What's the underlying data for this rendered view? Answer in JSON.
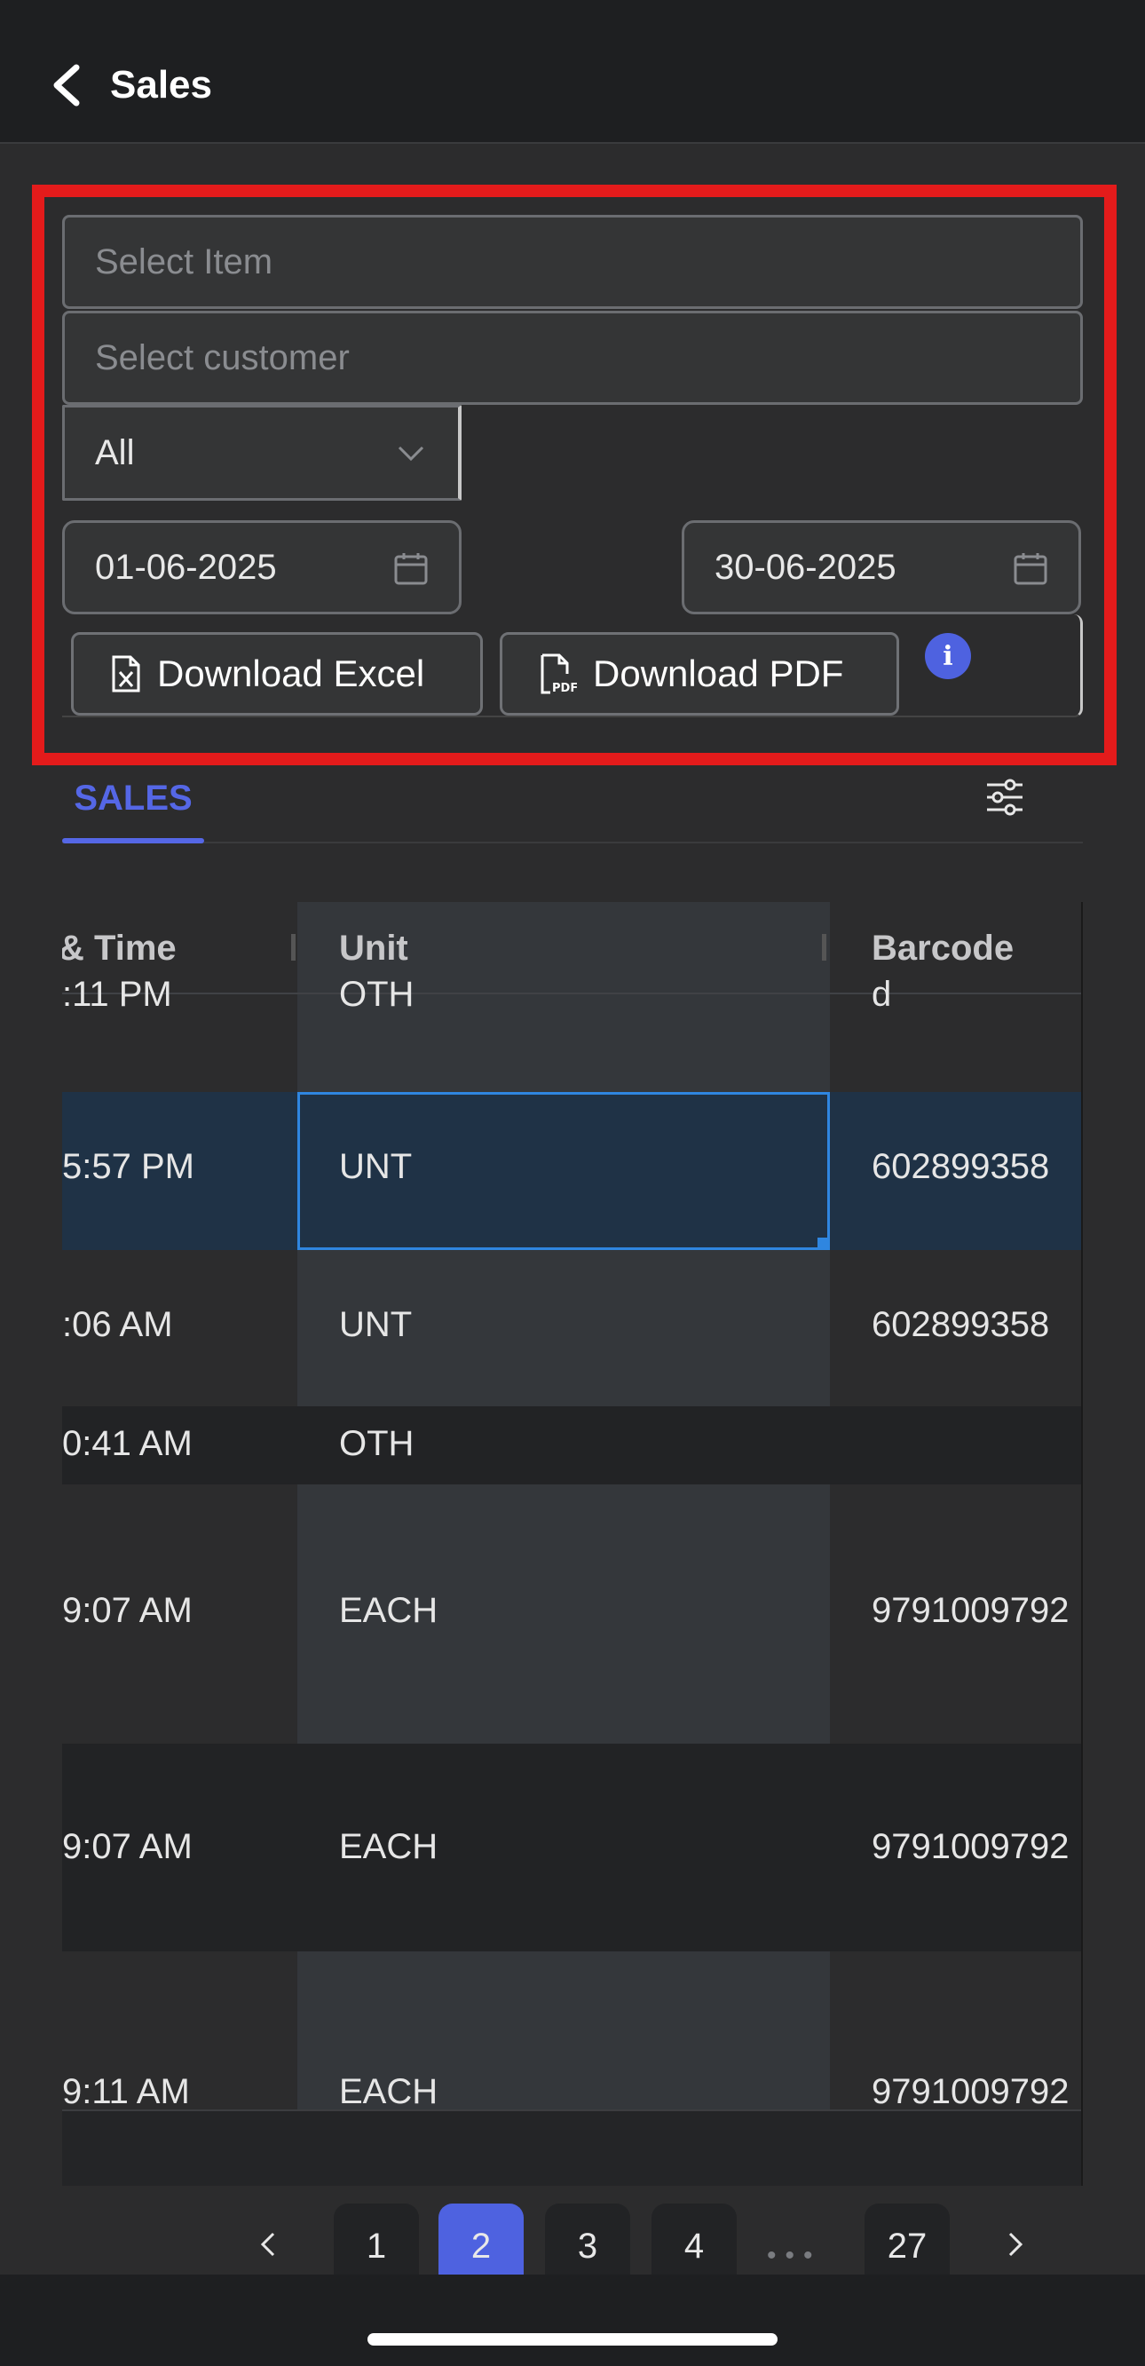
{
  "header": {
    "title": "Sales",
    "back_icon": "chevron-left-icon"
  },
  "filters": {
    "item_placeholder": "Select Item",
    "customer_placeholder": "Select customer",
    "type_select": {
      "value": "All"
    },
    "from_date": "01-06-2025",
    "to_date": "30-06-2025",
    "download_excel_label": "Download Excel",
    "download_pdf_label": "Download PDF",
    "info_icon_glyph": "i"
  },
  "tabs": [
    {
      "label": "SALES",
      "active": true
    }
  ],
  "grid": {
    "columns": [
      "& Time",
      "Unit",
      "Barcode"
    ],
    "rows": [
      {
        "time": ":11 PM",
        "unit": "OTH",
        "barcode": "d"
      },
      {
        "time": "5:57 PM",
        "unit": "UNT",
        "barcode": "602899358",
        "selected": true
      },
      {
        "time": ":06 AM",
        "unit": "UNT",
        "barcode": "602899358"
      },
      {
        "time": "0:41 AM",
        "unit": "OTH",
        "barcode": ""
      },
      {
        "time": "9:07 AM",
        "unit": "EACH",
        "barcode": "9791009792"
      },
      {
        "time": "9:07 AM",
        "unit": "EACH",
        "barcode": "9791009792"
      },
      {
        "time": "9:11 AM",
        "unit": "EACH",
        "barcode": "9791009792"
      }
    ]
  },
  "pagination": {
    "pages": [
      "1",
      "2",
      "3",
      "4"
    ],
    "ellipsis": "•••",
    "last_page": "27",
    "current": "2"
  },
  "colors": {
    "accent": "#4e62e0",
    "highlight_border": "#e41b1b",
    "selection": "#2f86e0"
  }
}
